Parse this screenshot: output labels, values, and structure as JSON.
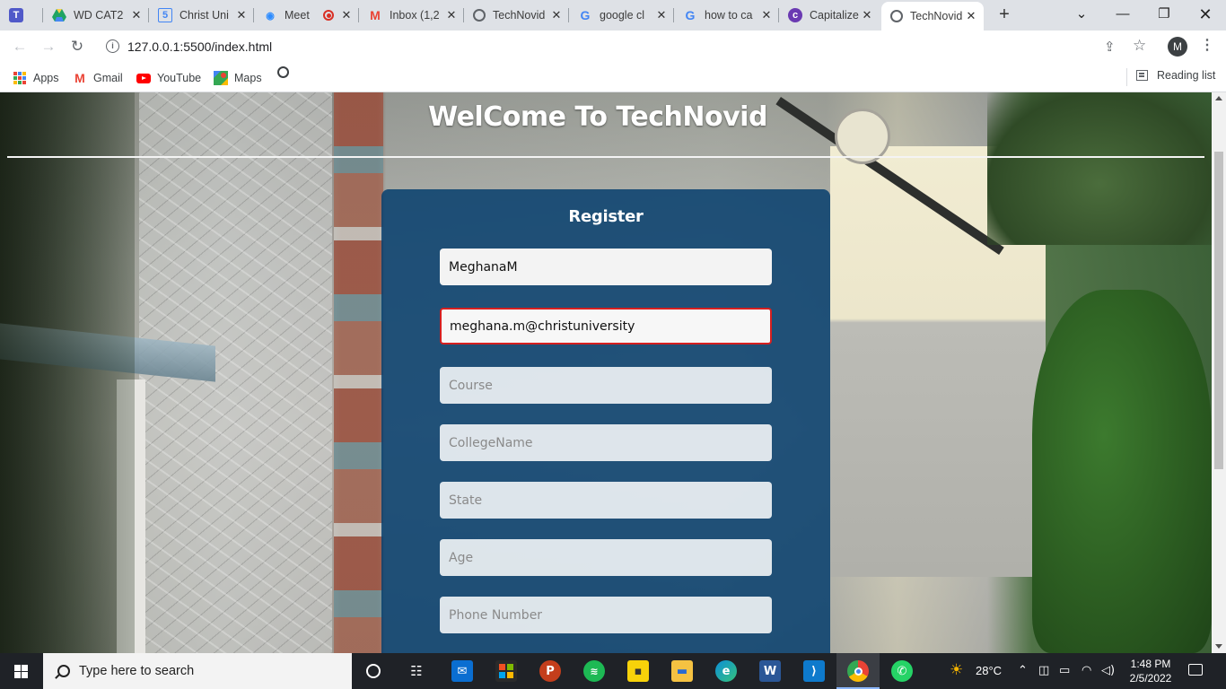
{
  "browser": {
    "tabs": [
      {
        "title": "",
        "icon": "teams-icon",
        "color": "#5059c9"
      },
      {
        "title": "WD CAT2",
        "icon": "google-drive-icon",
        "color": "#1fa463"
      },
      {
        "title": "Christ Uni",
        "icon": "calendar-5-icon",
        "color": "#4285f4"
      },
      {
        "title": "Meet",
        "icon": "meet-icon",
        "color": "#2d8cff"
      },
      {
        "title": "Inbox (1,2",
        "icon": "gmail-icon",
        "color": "#ea4335"
      },
      {
        "title": "TechNovid",
        "icon": "globe-icon",
        "color": "#5f6368"
      },
      {
        "title": "google cl",
        "icon": "google-icon",
        "color": "#4285f4"
      },
      {
        "title": "how to ca",
        "icon": "google-icon",
        "color": "#4285f4"
      },
      {
        "title": "Capitalize",
        "icon": "capitalize-icon",
        "color": "#6a3ab2"
      },
      {
        "title": "TechNovid",
        "icon": "globe-icon",
        "color": "#5f6368",
        "active": true
      }
    ],
    "url": "127.0.0.1:5500/index.html",
    "profile_initial": "M",
    "bookmarks": [
      {
        "label": "Apps",
        "icon": "apps-grid-icon"
      },
      {
        "label": "Gmail",
        "icon": "gmail-icon"
      },
      {
        "label": "YouTube",
        "icon": "youtube-icon"
      },
      {
        "label": "Maps",
        "icon": "maps-icon"
      }
    ],
    "reading_list": "Reading list"
  },
  "page": {
    "title": "WelCome To TechNovid",
    "form": {
      "heading": "Register",
      "fields": [
        {
          "name": "name",
          "value": "MeghanaM",
          "placeholder": ""
        },
        {
          "name": "email",
          "value": "meghana.m@christuniversity",
          "placeholder": ""
        },
        {
          "name": "course",
          "value": "",
          "placeholder": "Course"
        },
        {
          "name": "college",
          "value": "",
          "placeholder": "CollegeName"
        },
        {
          "name": "state",
          "value": "",
          "placeholder": "State"
        },
        {
          "name": "age",
          "value": "",
          "placeholder": "Age"
        },
        {
          "name": "phone",
          "value": "",
          "placeholder": "Phone Number"
        }
      ]
    }
  },
  "taskbar": {
    "search_placeholder": "Type here to search",
    "weather": "28°C",
    "time": "1:48 PM",
    "date": "2/5/2022",
    "apps": [
      {
        "icon": "cortana-icon"
      },
      {
        "icon": "task-view-icon"
      },
      {
        "icon": "mail-icon"
      },
      {
        "icon": "store-icon"
      },
      {
        "icon": "powerpoint-icon"
      },
      {
        "icon": "spotify-icon"
      },
      {
        "icon": "sticky-notes-icon"
      },
      {
        "icon": "file-explorer-icon"
      },
      {
        "icon": "edge-icon"
      },
      {
        "icon": "word-icon"
      },
      {
        "icon": "vscode-icon"
      },
      {
        "icon": "chrome-icon"
      },
      {
        "icon": "whatsapp-icon"
      }
    ]
  }
}
